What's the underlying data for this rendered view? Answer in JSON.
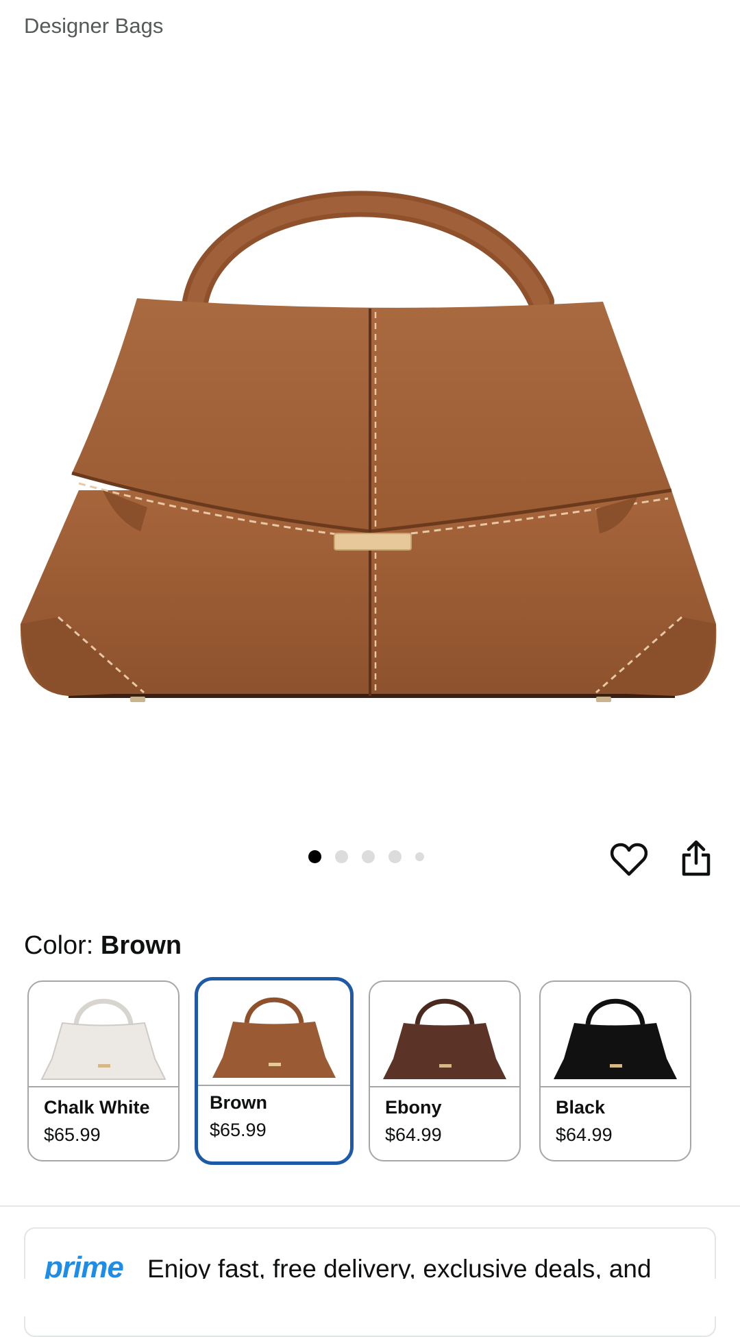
{
  "product": {
    "brand_line": "Designer Bags",
    "image_alt": "Brown leather top-handle handbag"
  },
  "gallery": {
    "dots_count": 5,
    "active_index": 0
  },
  "actions": {
    "favorite_icon": "heart-icon",
    "share_icon": "share-icon"
  },
  "color_selector": {
    "label": "Color: ",
    "selected_value": "Brown",
    "options": [
      {
        "name": "Chalk White",
        "price": "$65.99",
        "color": "#ece9e4"
      },
      {
        "name": "Brown",
        "price": "$65.99",
        "color": "#9a5a33"
      },
      {
        "name": "Ebony",
        "price": "$64.99",
        "color": "#5b3427"
      },
      {
        "name": "Black",
        "price": "$64.99",
        "color": "#111111"
      }
    ]
  },
  "prime": {
    "logo": "prime",
    "text": "Enjoy fast, free delivery, exclusive deals, and"
  },
  "colors": {
    "selected_border": "#1e5aa8",
    "prime_blue": "#1f8ce6"
  }
}
